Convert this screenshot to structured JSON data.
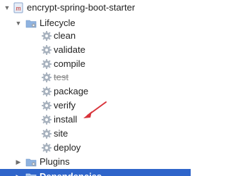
{
  "project": {
    "name": "encrypt-spring-boot-starter",
    "expanded": true
  },
  "lifecycle": {
    "label": "Lifecycle",
    "expanded": true,
    "goals": [
      {
        "label": "clean",
        "skipped": false
      },
      {
        "label": "validate",
        "skipped": false
      },
      {
        "label": "compile",
        "skipped": false
      },
      {
        "label": "test",
        "skipped": true
      },
      {
        "label": "package",
        "skipped": false
      },
      {
        "label": "verify",
        "skipped": false
      },
      {
        "label": "install",
        "skipped": false
      },
      {
        "label": "site",
        "skipped": false
      },
      {
        "label": "deploy",
        "skipped": false
      }
    ]
  },
  "plugins": {
    "label": "Plugins",
    "expanded": false
  },
  "dependencies": {
    "label": "Dependencies",
    "expanded": false,
    "selected": true
  },
  "icons": {
    "expanded_arrow": "chevron-down-icon",
    "collapsed_arrow": "chevron-right-icon",
    "project": "maven-module-icon",
    "lifecycle_folder": "folder-icon",
    "goal": "gear-icon",
    "annotation": "red-arrow-icon"
  },
  "colors": {
    "selection": "#2f65ca",
    "folder": "#8fb3e0",
    "gear": "#a9b3bf",
    "annotation": "#d8333a"
  }
}
